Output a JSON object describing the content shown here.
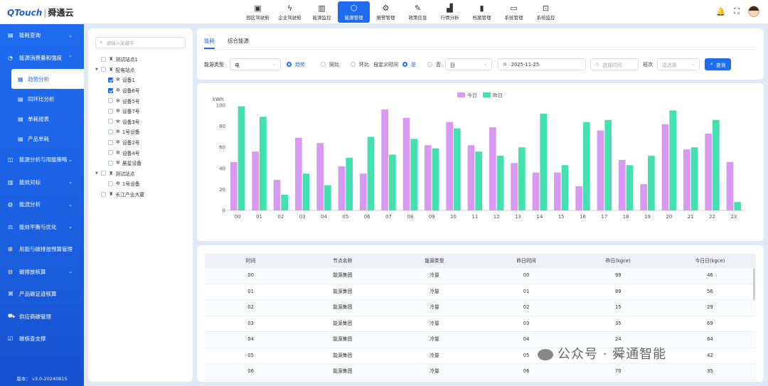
{
  "app": {
    "logo_brand": "QTouch",
    "logo_cn": "舜通云"
  },
  "topnav": [
    {
      "label": "园区驾驶舱",
      "icon": "dashboard-icon"
    },
    {
      "label": "企业驾驶舱",
      "icon": "bolt-icon"
    },
    {
      "label": "能源监控",
      "icon": "bar-chart-icon"
    },
    {
      "label": "能源管理",
      "icon": "shield-gear-icon",
      "active": true
    },
    {
      "label": "报警管理",
      "icon": "alarm-icon"
    },
    {
      "label": "政策信息",
      "icon": "document-edit-icon"
    },
    {
      "label": "行情分析",
      "icon": "trend-icon"
    },
    {
      "label": "档案管理",
      "icon": "archive-icon"
    },
    {
      "label": "系统管理",
      "icon": "monitor-icon"
    },
    {
      "label": "系统监控",
      "icon": "monitor-chart-icon"
    }
  ],
  "sidebar": {
    "items": [
      {
        "label": "能耗查询",
        "arrow": "⌄"
      },
      {
        "label": "能源消费量和强度",
        "arrow": "⌃"
      },
      {
        "label": "能源分析与用能策略",
        "arrow": "⌄"
      },
      {
        "label": "能效对标",
        "arrow": "⌄"
      },
      {
        "label": "能流分析",
        "arrow": "⌄"
      },
      {
        "label": "能效平衡与优化",
        "arrow": "⌄"
      },
      {
        "label": "用能与碳排放预算管理",
        "arrow": ""
      },
      {
        "label": "碳排放核算",
        "arrow": "⌄"
      },
      {
        "label": "产品碳足迹核算",
        "arrow": ""
      },
      {
        "label": "供应商碳管理",
        "arrow": ""
      },
      {
        "label": "碳核查支撑",
        "arrow": ""
      }
    ],
    "subitems": [
      {
        "label": "趋势分析",
        "active": true
      },
      {
        "label": "同环比分析"
      },
      {
        "label": "单耗报表"
      },
      {
        "label": "产品单耗"
      }
    ],
    "version": "版本： v3.0-20240815"
  },
  "tree": {
    "search_placeholder": "请输入关键字",
    "nodes": [
      {
        "label": "测试站点1",
        "level": 0,
        "caret": "",
        "checked": false,
        "icon": "site-icon"
      },
      {
        "label": "配电站点",
        "level": 0,
        "caret": "▼",
        "checked": false,
        "icon": "site-icon"
      },
      {
        "label": "设备1",
        "level": 1,
        "caret": "",
        "checked": true,
        "icon": "device-icon"
      },
      {
        "label": "设备6号",
        "level": 1,
        "caret": "",
        "checked": true,
        "icon": "device-icon"
      },
      {
        "label": "设备5号",
        "level": 1,
        "caret": "",
        "checked": false,
        "icon": "device-icon"
      },
      {
        "label": "设备7号",
        "level": 1,
        "caret": "",
        "checked": false,
        "icon": "device-icon"
      },
      {
        "label": "设备3号",
        "level": 1,
        "caret": "",
        "checked": false,
        "icon": "device-icon"
      },
      {
        "label": "1号设备",
        "level": 1,
        "caret": "",
        "checked": false,
        "icon": "device-icon"
      },
      {
        "label": "设备2号",
        "level": 1,
        "caret": "",
        "checked": false,
        "icon": "device-icon"
      },
      {
        "label": "设备4号",
        "level": 1,
        "caret": "",
        "checked": false,
        "icon": "device-icon"
      },
      {
        "label": "晨星设备",
        "level": 1,
        "caret": "",
        "checked": false,
        "icon": "device-icon"
      },
      {
        "label": "测试站点",
        "level": 0,
        "caret": "▼",
        "checked": false,
        "icon": "site-icon"
      },
      {
        "label": "1号设备",
        "level": 1,
        "caret": "",
        "checked": false,
        "icon": "device-icon"
      },
      {
        "label": "长江产业大厦",
        "level": 0,
        "caret": "",
        "checked": false,
        "icon": "site-icon"
      }
    ]
  },
  "filter": {
    "tabs": [
      "能耗",
      "综合能源"
    ],
    "energy_type_label": "能源类型",
    "energy_type_value": "电",
    "mode_options": [
      {
        "label": "趋势",
        "checked": true
      },
      {
        "label": "同比",
        "checked": false
      },
      {
        "label": "环比",
        "checked": false
      }
    ],
    "custom_time_label": "自定义时间",
    "custom_options": [
      {
        "label": "是",
        "checked": true
      },
      {
        "label": "否",
        "checked": false
      }
    ],
    "period_value": "日",
    "date_value": "2025-11-25",
    "time_placeholder": "选择时间",
    "shift_label": "班次",
    "shift_placeholder": "请选择",
    "query_label": "查询",
    "colors": {
      "accent": "#1f6cf0"
    }
  },
  "chart_data": {
    "type": "bar",
    "ylabel": "kWh",
    "ylim": [
      0,
      100
    ],
    "yticks": [
      0,
      20,
      40,
      60,
      80,
      100
    ],
    "categories": [
      "00",
      "01",
      "02",
      "03",
      "04",
      "05",
      "06",
      "07",
      "08",
      "09",
      "10",
      "11",
      "12",
      "13",
      "14",
      "15",
      "16",
      "17",
      "18",
      "19",
      "20",
      "21",
      "22",
      "23"
    ],
    "series": [
      {
        "name": "今日",
        "color": "#d89af0",
        "values": [
          46,
          56,
          29,
          69,
          64,
          42,
          35,
          96,
          88,
          62,
          84,
          62,
          79,
          45,
          36,
          36,
          23,
          76,
          48,
          25,
          82,
          58,
          73,
          46
        ]
      },
      {
        "name": "昨日",
        "color": "#43e1b0",
        "values": [
          99,
          89,
          15,
          35,
          24,
          50,
          70,
          53,
          68,
          59,
          78,
          56,
          52,
          60,
          92,
          43,
          84,
          86,
          43,
          52,
          95,
          60,
          86,
          8
        ]
      }
    ],
    "legend": "top-center",
    "grid": false
  },
  "table": {
    "columns": [
      "时间",
      "节点名称",
      "能源类型",
      "昨日时间",
      "昨日(kgce)",
      "今日日(kgce)"
    ],
    "rows": [
      [
        "00",
        "能源集团",
        "冷量",
        "00",
        "99",
        "46"
      ],
      [
        "01",
        "能源集团",
        "冷量",
        "01",
        "89",
        "56"
      ],
      [
        "02",
        "能源集团",
        "冷量",
        "02",
        "15",
        "29"
      ],
      [
        "03",
        "能源集团",
        "冷量",
        "03",
        "35",
        "69"
      ],
      [
        "04",
        "能源集团",
        "冷量",
        "04",
        "24",
        "64"
      ],
      [
        "05",
        "能源集团",
        "冷量",
        "05",
        "50",
        "42"
      ],
      [
        "06",
        "能源集团",
        "冷量",
        "06",
        "70",
        "35"
      ]
    ]
  },
  "watermark": {
    "text": "公众号 · 舜通智能"
  }
}
